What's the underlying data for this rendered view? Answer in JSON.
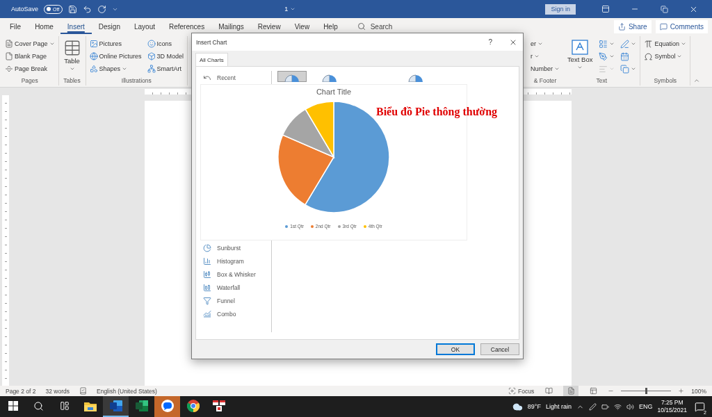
{
  "title_bar": {
    "autosave_label": "AutoSave",
    "autosave_toggle": {
      "label": "Off",
      "on": false
    },
    "document_title": "1",
    "sign_in": "Sign in"
  },
  "ribbon_tabs": [
    {
      "label": "File",
      "selected": false
    },
    {
      "label": "Home",
      "selected": false
    },
    {
      "label": "Insert",
      "selected": true
    },
    {
      "label": "Design",
      "selected": false
    },
    {
      "label": "Layout",
      "selected": false
    },
    {
      "label": "References",
      "selected": false
    },
    {
      "label": "Mailings",
      "selected": false
    },
    {
      "label": "Review",
      "selected": false
    },
    {
      "label": "View",
      "selected": false
    },
    {
      "label": "Help",
      "selected": false
    }
  ],
  "tell_me": {
    "placeholder": "Search"
  },
  "share": "Share",
  "comments": "Comments",
  "ribbon_left": [
    {
      "label": "Pages",
      "kind": "stack",
      "items": [
        {
          "label": "Cover Page",
          "dropdown": true
        },
        {
          "label": "Blank Page",
          "dropdown": false
        },
        {
          "label": "Page Break",
          "dropdown": false
        }
      ]
    },
    {
      "label": "Tables",
      "kind": "large",
      "items": [
        {
          "label": "Table",
          "dropdown": true
        }
      ]
    },
    {
      "label": "Illustrations",
      "kind": "columns",
      "items": [
        {
          "label": "Pictures",
          "dropdown": false
        },
        {
          "label": "Online Pictures",
          "dropdown": false
        },
        {
          "label": "Shapes",
          "dropdown": true
        },
        {
          "label": "Icons",
          "dropdown": false
        },
        {
          "label": "3D Model",
          "dropdown": false
        },
        {
          "label": "SmartArt",
          "dropdown": false
        }
      ]
    }
  ],
  "ribbon_right": [
    {
      "label": "& Footer",
      "kind": "stack",
      "items": [
        {
          "label": "er",
          "dropdown": true
        },
        {
          "label": "r",
          "dropdown": true
        },
        {
          "label": "Number",
          "dropdown": true
        }
      ]
    },
    {
      "label": "Text",
      "kind": "text",
      "items": [
        {
          "label": "Text Box",
          "dropdown": true
        }
      ],
      "icon_buttons": [
        {
          "dropdown": true,
          "disabled": false
        },
        {
          "dropdown": true,
          "disabled": false
        },
        {
          "dropdown": true,
          "disabled": true
        },
        {
          "dropdown": true,
          "disabled": false
        },
        {
          "dropdown": false,
          "disabled": false
        },
        {
          "dropdown": true,
          "disabled": false
        }
      ]
    },
    {
      "label": "Symbols",
      "kind": "symbols",
      "items": [
        {
          "label": "Equation",
          "dropdown": true
        },
        {
          "label": "Symbol",
          "dropdown": true
        }
      ]
    }
  ],
  "dialog": {
    "title": "Insert Chart",
    "help": "?",
    "tabs": [
      {
        "label": "All Charts",
        "selected": true
      }
    ],
    "chart_types": [
      {
        "label": "Recent",
        "selected": false
      },
      {
        "label": "Sunburst",
        "selected": false
      },
      {
        "label": "Histogram",
        "selected": false
      },
      {
        "label": "Box & Whisker",
        "selected": false
      },
      {
        "label": "Waterfall",
        "selected": false
      },
      {
        "label": "Funnel",
        "selected": false
      },
      {
        "label": "Combo",
        "selected": false
      }
    ],
    "thumbnails": [
      {
        "selected": true
      },
      {
        "selected": false
      },
      {
        "selected": false
      }
    ],
    "preview": {
      "title": "Chart Title",
      "legend": [
        {
          "label": "1st Qtr",
          "color": "#5b9bd5"
        },
        {
          "label": "2nd Qtr",
          "color": "#ed7d31"
        },
        {
          "label": "3rd Qtr",
          "color": "#a5a5a5"
        },
        {
          "label": "4th Qtr",
          "color": "#ffc000"
        }
      ]
    },
    "annotation": "Biểu đồ Pie thông thường",
    "buttons": [
      {
        "label": "OK",
        "default": true
      },
      {
        "label": "Cancel",
        "default": false
      }
    ]
  },
  "status_bar": {
    "page": "Page 2 of 2",
    "words": "32 words",
    "language": "English (United States)",
    "focus": "Focus",
    "views": [
      {
        "selected": false
      },
      {
        "selected": true
      },
      {
        "selected": false
      }
    ],
    "zoom": {
      "level": 0.5,
      "reading": "100%"
    }
  },
  "taskbar": {
    "apps": [
      {
        "kind": "explorer",
        "active": false,
        "flashing": false
      },
      {
        "kind": "word",
        "active": true,
        "flashing": false
      },
      {
        "kind": "excel",
        "active": false,
        "flashing": false
      },
      {
        "kind": "zalo",
        "active": false,
        "flashing": true
      },
      {
        "kind": "chrome",
        "active": false,
        "flashing": false
      },
      {
        "kind": "app",
        "active": false,
        "flashing": false
      }
    ],
    "weather": {
      "temperature": "89°F",
      "condition": "Light rain"
    },
    "language": "ENG",
    "time": "7:25 PM",
    "date": "10/15/2021",
    "notifications": "2"
  }
}
